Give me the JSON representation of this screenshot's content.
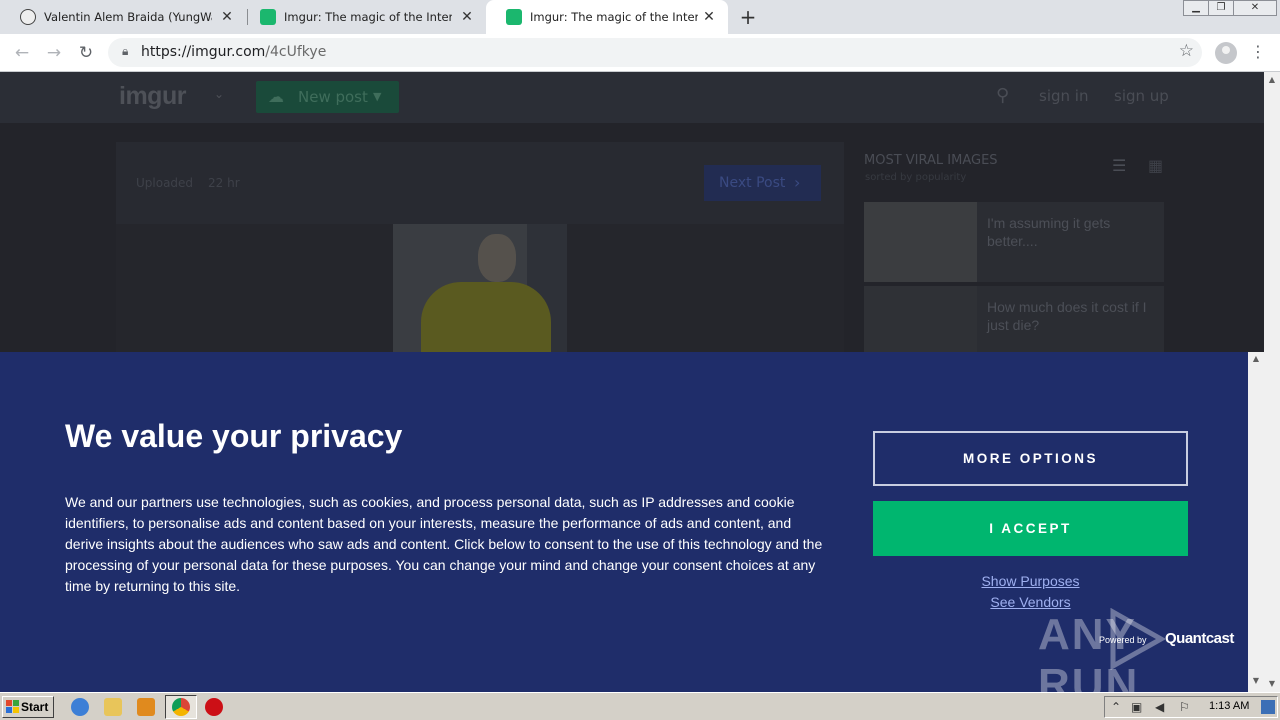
{
  "browser": {
    "tabs": [
      {
        "title": "Valentin Alem Braida (YungWaffen) -",
        "active": false
      },
      {
        "title": "Imgur: The magic of the Internet",
        "active": false
      },
      {
        "title": "Imgur: The magic of the Internet",
        "active": true
      }
    ],
    "url_host": "https://imgur.com",
    "url_path": "/4cUfkye"
  },
  "imgur": {
    "logo": "imgur",
    "new_post": "New post",
    "sign_in": "sign in",
    "sign_up": "sign up",
    "uploaded_label": "Uploaded",
    "uploaded_time": "22 hr",
    "next_post": "Next Post",
    "viral_title": "MOST VIRAL IMAGES",
    "viral_subtitle": "sorted by popularity",
    "viral_items": [
      {
        "caption": "I'm assuming it gets better...."
      },
      {
        "caption": "How much does it cost if I just die?"
      }
    ]
  },
  "privacy": {
    "title": "We value your privacy",
    "body": "We and our partners use technologies, such as cookies, and process personal data, such as IP addresses and cookie identifiers, to personalise ads and content based on your interests, measure the performance of ads and content, and derive insights about the audiences who saw ads and content. Click below to consent to the use of this technology and the processing of your personal data for these purposes. You can change your mind and change your consent choices at any time by returning to this site.",
    "more_options": "MORE OPTIONS",
    "accept": "I ACCEPT",
    "show_purposes": "Show Purposes",
    "see_vendors": "See Vendors",
    "powered_by": "Powered by",
    "vendor": "Quantcast",
    "accent_color": "#00b66f",
    "background_color": "#1f2d6a"
  },
  "watermark": "ANY RUN",
  "taskbar": {
    "start": "Start",
    "clock": "1:13 AM"
  }
}
